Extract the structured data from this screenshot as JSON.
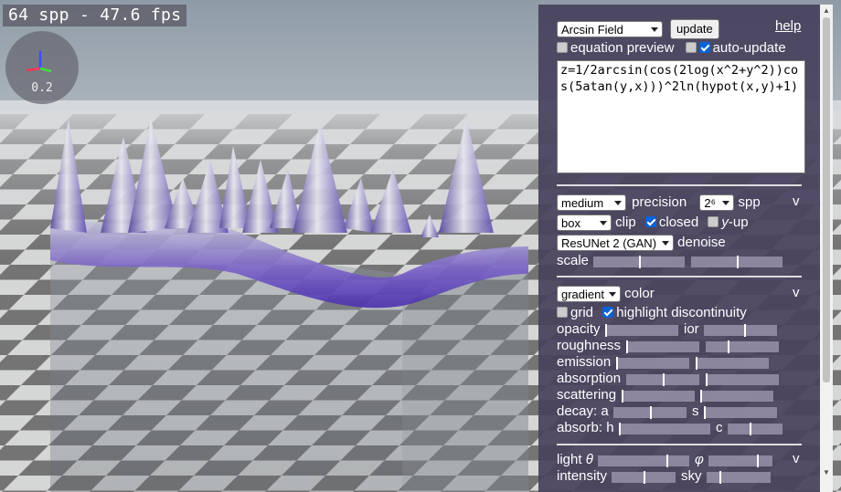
{
  "stats": "64 spp - 47.6 fps",
  "gizmo": {
    "scale": "0.2"
  },
  "panel": {
    "function_select": "Arcsin Field",
    "update_label": "update",
    "help_label": "help",
    "equation_preview_label": "equation preview",
    "equation_preview_checked": false,
    "auto_update_label": "auto-update",
    "auto_update_checked": true,
    "equation": "z=1/2arcsin(cos(2log(x^2+y^2))cos(5atan(y,x)))^2ln(hypot(x,y)+1)",
    "render": {
      "precision_select": "medium",
      "precision_label": "precision",
      "spp_select": "2⁶",
      "spp_label": "spp",
      "collapse": "v",
      "clip_select": "box",
      "clip_label": "clip",
      "closed_label": "closed",
      "closed_checked": true,
      "yup_label": "-up",
      "yup_italic": "y",
      "yup_checked": false,
      "denoise_select": "ResUNet 2 (GAN)",
      "denoise_label": "denoise",
      "scale_label": "scale",
      "scale_values": [
        0.5,
        0.5
      ]
    },
    "material": {
      "color_select": "gradient",
      "color_label": "color",
      "collapse": "v",
      "grid_label": "grid",
      "grid_checked": false,
      "highlight_label": "highlight discontinuity",
      "highlight_checked": true,
      "opacity_label": "opacity",
      "opacity_value": 0.0,
      "ior_label": "ior",
      "ior_value": 0.55,
      "roughness_label": "roughness",
      "roughness_values": [
        0.0,
        0.3
      ],
      "emission_label": "emission",
      "emission_values": [
        0.0,
        0.0
      ],
      "absorption_label": "absorption",
      "absorption_values": [
        0.5,
        0.0
      ],
      "scattering_label": "scattering",
      "scattering_values": [
        0.0,
        0.0
      ],
      "decay_label": "decay: a",
      "decay_a": 0.5,
      "decay_s_label": "s",
      "decay_s": 0.0,
      "absorb_label": "absorb: h",
      "absorb_h": 0.0,
      "absorb_c_label": "c",
      "absorb_c": 0.4
    },
    "light": {
      "theta_label": "light",
      "theta_symbol": "θ",
      "theta_value": 0.75,
      "phi_symbol": "φ",
      "phi_value": 0.75,
      "collapse": "v",
      "intensity_label": "intensity",
      "intensity_value": 0.5,
      "sky_label": "sky",
      "sky_value": 0.2
    }
  }
}
